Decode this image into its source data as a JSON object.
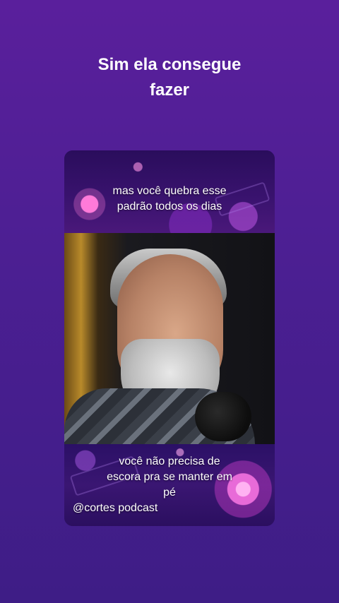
{
  "headline": {
    "line1": "Sim ela consegue",
    "line2": "fazer"
  },
  "card": {
    "caption_top": {
      "line1": "mas você quebra esse",
      "line2": "padrão todos os dias"
    },
    "caption_bottom": {
      "line1": "você não precisa de",
      "line2": "escora pra se manter em",
      "line3": "pé"
    },
    "watermark": "@cortes podcast"
  },
  "colors": {
    "background": "#4b1f92",
    "text": "#ffffff"
  }
}
